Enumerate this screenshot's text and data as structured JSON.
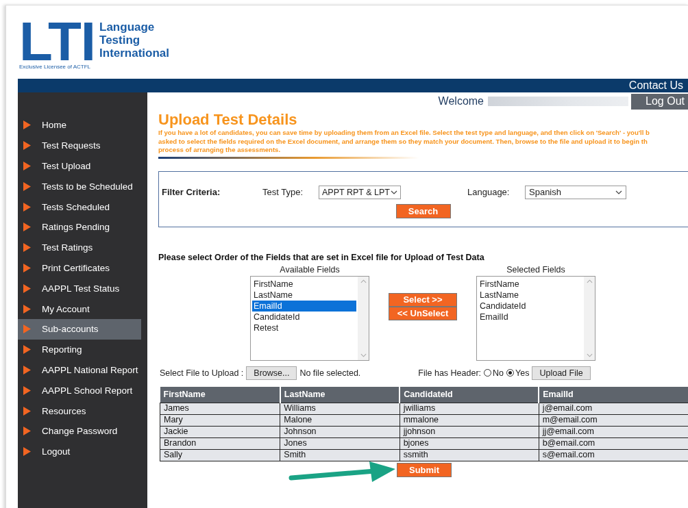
{
  "logo": {
    "letters": "LTI",
    "name_lines": [
      "Language",
      "Testing",
      "International"
    ],
    "tagline": "Exclusive Licensee of ACTFL"
  },
  "header": {
    "contact": "Contact Us",
    "welcome": "Welcome",
    "logout": "Log Out"
  },
  "sidebar": {
    "items": [
      {
        "label": "Home",
        "selected": false
      },
      {
        "label": "Test Requests",
        "selected": false
      },
      {
        "label": "Test Upload",
        "selected": false
      },
      {
        "label": "Tests to be Scheduled",
        "selected": false
      },
      {
        "label": "Tests Scheduled",
        "selected": false
      },
      {
        "label": "Ratings Pending",
        "selected": false
      },
      {
        "label": "Test Ratings",
        "selected": false
      },
      {
        "label": "Print Certificates",
        "selected": false
      },
      {
        "label": "AAPPL Test Status",
        "selected": false
      },
      {
        "label": "My Account",
        "selected": false
      },
      {
        "label": "Sub-accounts",
        "selected": true
      },
      {
        "label": "Reporting",
        "selected": false
      },
      {
        "label": "AAPPL National Report",
        "selected": false
      },
      {
        "label": "AAPPL School Report",
        "selected": false
      },
      {
        "label": "Resources",
        "selected": false
      },
      {
        "label": "Change Password",
        "selected": false
      },
      {
        "label": "Logout",
        "selected": false
      }
    ]
  },
  "page": {
    "title": "Upload Test Details",
    "description_lines": [
      "If you have a lot of candidates, you can save time by uploading them from an Excel file. Select the test type and language, and then click on 'Search' - you'll b",
      "asked to select the fields required on the Excel document, and arrange them so they match your document. Then, browse to the file and upload it to begin th",
      "process of arranging the assessments."
    ]
  },
  "filter": {
    "label": "Filter Criteria:",
    "test_type_label": "Test Type:",
    "test_type_value": "APPT RPT & LPT",
    "language_label": "Language:",
    "language_value": "Spanish",
    "search": "Search"
  },
  "fields": {
    "instruction": "Please select Order of the Fields that are set in Excel file for Upload of Test Data",
    "available": {
      "title": "Available Fields",
      "items": [
        {
          "label": "FirstName",
          "selected": false
        },
        {
          "label": "LastName",
          "selected": false
        },
        {
          "label": "EmailId",
          "selected": true
        },
        {
          "label": "CandidateId",
          "selected": false
        },
        {
          "label": "Retest",
          "selected": false
        }
      ]
    },
    "chosen": {
      "title": "Selected Fields",
      "items": [
        {
          "label": "FirstName",
          "selected": false
        },
        {
          "label": "LastName",
          "selected": false
        },
        {
          "label": "CandidateId",
          "selected": false
        },
        {
          "label": "EmailId",
          "selected": false
        }
      ]
    },
    "select_button": "Select >>",
    "unselect_button": "<< UnSelect"
  },
  "upload": {
    "label": "Select File to Upload :",
    "browse": "Browse...",
    "file_status": "No file selected.",
    "header_label": "File has Header:",
    "options": [
      {
        "label": "No",
        "selected": false
      },
      {
        "label": "Yes",
        "selected": true
      }
    ],
    "upload_button": "Upload File"
  },
  "table": {
    "columns": [
      "FirstName",
      "LastName",
      "CandidateId",
      "EmailId"
    ],
    "rows": [
      [
        "James",
        "Williams",
        "jwilliams",
        "j@email.com"
      ],
      [
        "Mary",
        "Malone",
        "mmalone",
        "m@email.com"
      ],
      [
        "Jackie",
        "Johnson",
        "jjohnson",
        "jj@email.com"
      ],
      [
        "Brandon",
        "Jones",
        "bjones",
        "b@email.com"
      ],
      [
        "Sally",
        "Smith",
        "ssmith",
        "s@email.com"
      ]
    ]
  },
  "submit": "Submit"
}
